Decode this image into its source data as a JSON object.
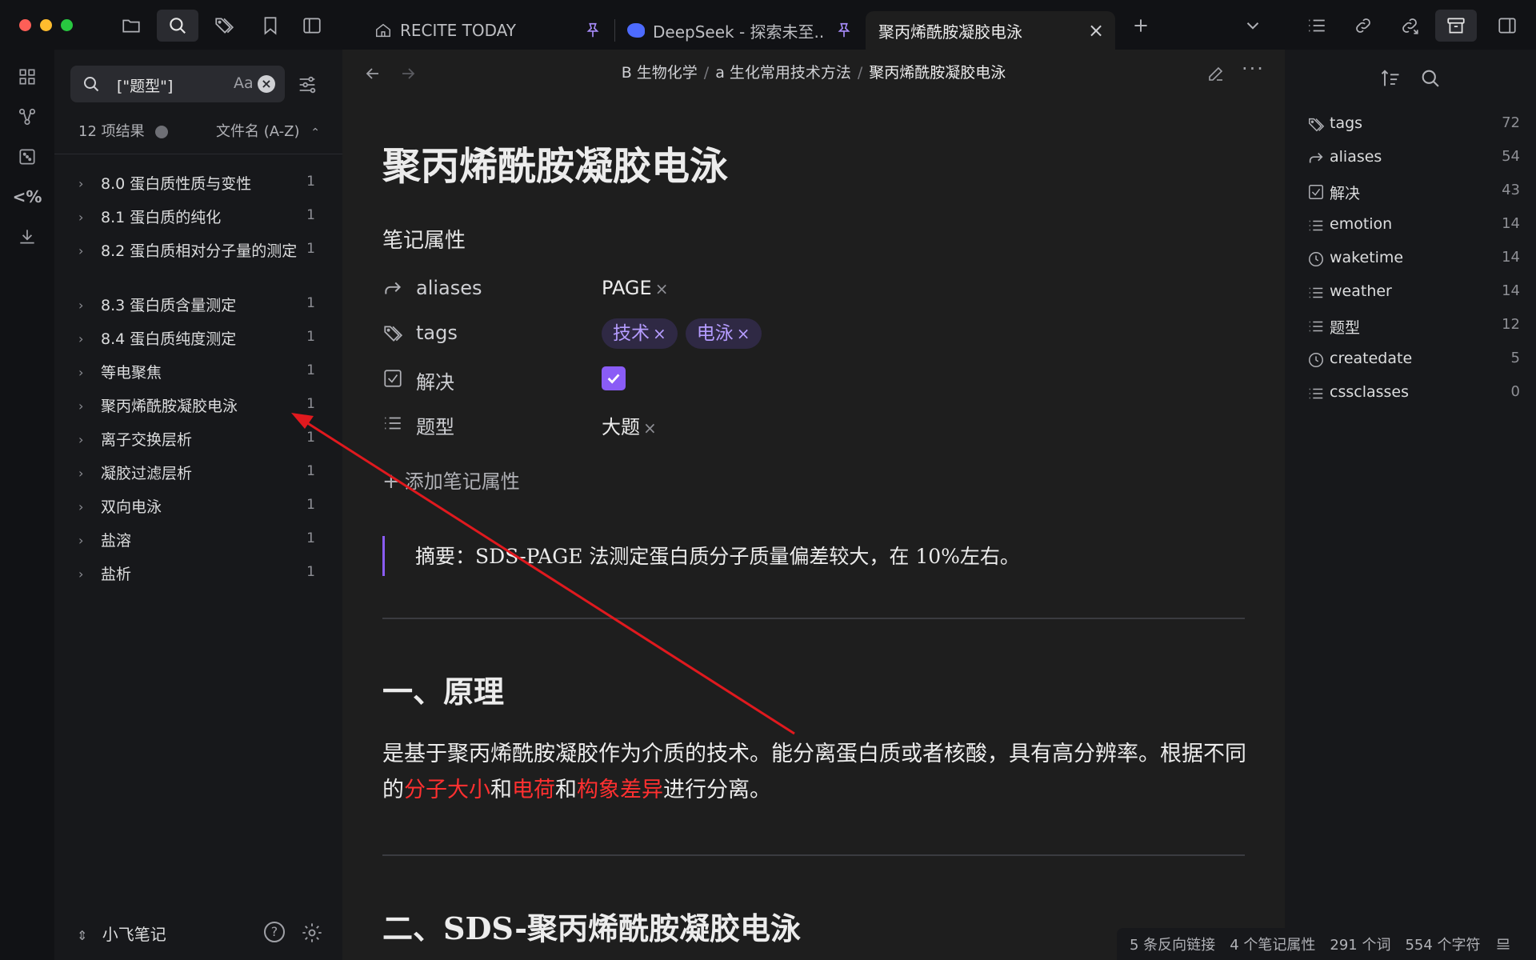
{
  "tabs": [
    {
      "label": "RECITE TODAY",
      "icon": "home-icon",
      "pinned": true
    },
    {
      "label": "DeepSeek - 探索未至...",
      "icon": "deepseek-icon",
      "pinned": true
    },
    {
      "label": "聚丙烯酰胺凝胶电泳",
      "active": true
    }
  ],
  "search": {
    "query": "[\"题型\"]",
    "match_case": "Aa",
    "result_count": "12 项结果",
    "sort": "文件名 (A-Z)"
  },
  "results": [
    {
      "title": "8.0 蛋白质性质与变性",
      "count": "1"
    },
    {
      "title": "8.1 蛋白质的纯化",
      "count": "1"
    },
    {
      "title": "8.2 蛋白质相对分子量的测定",
      "count": "1"
    },
    {
      "title": "8.3 蛋白质含量测定",
      "count": "1"
    },
    {
      "title": "8.4 蛋白质纯度测定",
      "count": "1"
    },
    {
      "title": "等电聚焦",
      "count": "1"
    },
    {
      "title": "聚丙烯酰胺凝胶电泳",
      "count": "1"
    },
    {
      "title": "离子交换层析",
      "count": "1"
    },
    {
      "title": "凝胶过滤层析",
      "count": "1"
    },
    {
      "title": "双向电泳",
      "count": "1"
    },
    {
      "title": "盐溶",
      "count": "1"
    },
    {
      "title": "盐析",
      "count": "1"
    }
  ],
  "vault_name": "小飞笔记",
  "breadcrumb": [
    "B 生物化学",
    "a 生化常用技术方法",
    "聚丙烯酰胺凝胶电泳"
  ],
  "note": {
    "title": "聚丙烯酰胺凝胶电泳",
    "properties_heading": "笔记属性",
    "properties": {
      "aliases_key": "aliases",
      "aliases_value": "PAGE",
      "tags_key": "tags",
      "tags_values": [
        "技术",
        "电泳"
      ],
      "solved_key": "解决",
      "solved_checked": true,
      "type_key": "题型",
      "type_value": "大题"
    },
    "add_property": "添加笔记属性",
    "quote": "摘要：SDS-PAGE 法测定蛋白质分子质量偏差较大，在 10%左右。",
    "h2_1": "一、原理",
    "para_parts": [
      "是基于聚丙烯酰胺凝胶作为介质的技术。能分离蛋白质或者核酸，具有高分辨率。根据不同的",
      "分子大小",
      "和",
      "电荷",
      "和",
      "构象差异",
      "进行分离。"
    ],
    "h2_2": "二、SDS-聚丙烯酰胺凝胶电泳"
  },
  "property_list": [
    {
      "name": "tags",
      "count": "72",
      "icon": "tag-icon"
    },
    {
      "name": "aliases",
      "count": "54",
      "icon": "forward-arrow-icon"
    },
    {
      "name": "解决",
      "count": "43",
      "icon": "checkbox-icon"
    },
    {
      "name": "emotion",
      "count": "14",
      "icon": "list-icon"
    },
    {
      "name": "waketime",
      "count": "14",
      "icon": "clock-icon"
    },
    {
      "name": "weather",
      "count": "14",
      "icon": "list-icon"
    },
    {
      "name": "题型",
      "count": "12",
      "icon": "list-icon"
    },
    {
      "name": "createdate",
      "count": "5",
      "icon": "clock-icon"
    },
    {
      "name": "cssclasses",
      "count": "0",
      "icon": "list-icon"
    }
  ],
  "status": {
    "backlinks": "5 条反向链接",
    "properties": "4 个笔记属性",
    "words": "291 个词",
    "chars": "554 个字符"
  },
  "colors": {
    "accent": "#8a5cf6",
    "highlight_red": "#ff3030",
    "annotation_arrow": "#e0191e"
  }
}
